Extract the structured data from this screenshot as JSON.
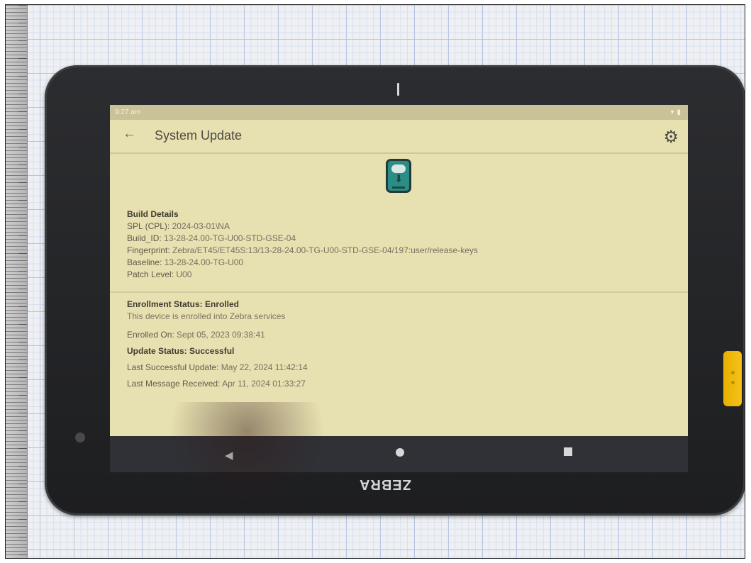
{
  "status_bar": {
    "time": "9:27 am",
    "icons": [
      "wifi-icon",
      "battery-icon"
    ]
  },
  "app_bar": {
    "title": "System Update",
    "back_icon": "arrow-left-icon",
    "settings_icon": "gear-icon"
  },
  "build_details": {
    "heading": "Build Details",
    "spl_label": "SPL (CPL):",
    "spl_value": "2024-03-01\\NA",
    "build_label": "Build_ID:",
    "build_value": "13-28-24.00-TG-U00-STD-GSE-04",
    "fingerprint_label": "Fingerprint:",
    "fingerprint_value": "Zebra/ET45/ET45S:13/13-28-24.00-TG-U00-STD-GSE-04/197:user/release-keys",
    "baseline_label": "Baseline:",
    "baseline_value": "13-28-24.00-TG-U00",
    "patch_label": "Patch Level:",
    "patch_value": "U00"
  },
  "enrollment": {
    "title": "Enrollment Status: Enrolled",
    "subtitle": "This device is enrolled into Zebra services",
    "enrolled_on_label": "Enrolled On:",
    "enrolled_on_value": "Sept 05, 2023 09:38:41",
    "update_status": "Update Status: Successful",
    "last_update_label": "Last Successful Update:",
    "last_update_value": "May 22, 2024 11:42:14",
    "last_message_label": "Last Message Received:",
    "last_message_value": "Apr 11, 2024 01:33:27"
  },
  "device": {
    "brand": "ZEBRA",
    "bezel_color": "#1f2023",
    "accent_button_color": "#f2c01d",
    "screen_background": "#e7e0b0"
  },
  "nav_bar": {
    "items": [
      "nav-back-icon",
      "nav-home-icon",
      "nav-recents-icon"
    ]
  }
}
